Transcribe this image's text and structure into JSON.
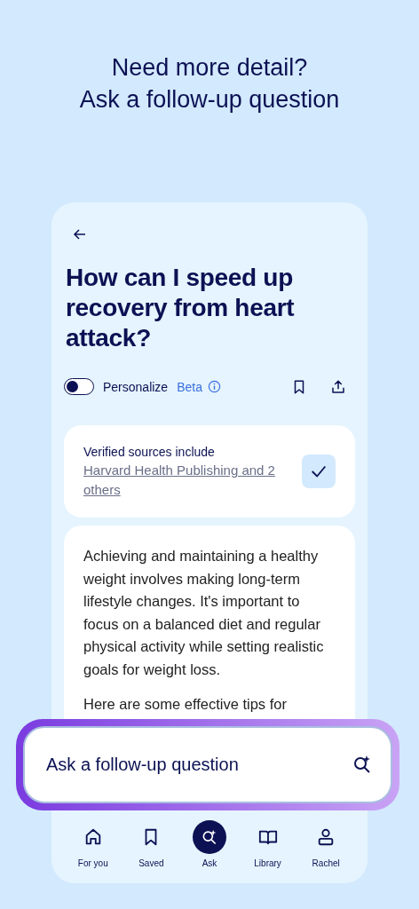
{
  "headline": [
    "Need more detail?",
    "Ask a follow-up question"
  ],
  "question": {
    "title": "How can I speed up recovery from heart attack?"
  },
  "personalize": {
    "label": "Personalize",
    "badge": "Beta",
    "on": false
  },
  "sources": {
    "heading": "Verified sources include",
    "link": "Harvard Health Publishing and 2 others",
    "verified": true
  },
  "answer": {
    "paragraphs": [
      "Achieving and maintaining a healthy weight involves making long-term lifestyle changes. It's important to focus on a balanced diet and regular physical activity while setting realistic goals for weight loss.",
      "Here are some effective tips for"
    ]
  },
  "follow_up": {
    "placeholder": "Ask a follow-up question"
  },
  "nav": [
    {
      "label": "For you",
      "kind": "home",
      "selected": false
    },
    {
      "label": "Saved",
      "kind": "bookmark",
      "selected": false
    },
    {
      "label": "Ask",
      "kind": "ask",
      "selected": true
    },
    {
      "label": "Library",
      "kind": "book",
      "selected": false
    },
    {
      "label": "Rachel",
      "kind": "person",
      "selected": false
    }
  ]
}
